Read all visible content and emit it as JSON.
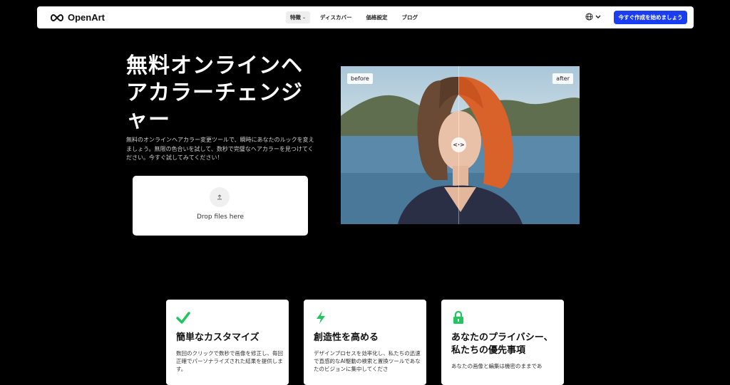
{
  "nav": {
    "logo": "OpenArt",
    "links": [
      {
        "label": "特徴",
        "has_chevron": true
      },
      {
        "label": "ディスカバー"
      },
      {
        "label": "価格設定"
      },
      {
        "label": "ブログ"
      }
    ],
    "cta": "今すぐ作成を始めましょう"
  },
  "hero": {
    "title_lines": [
      "無料オンラインヘ",
      "アカラーチェンジ",
      "ャー"
    ],
    "description": "無料のオンラインヘアカラー変更ツールで、瞬時にあなたのルックを変えましょう。無限の色合いを試して、数秒で完璧なヘアカラーを見つけてください。今すぐ試してみてください！",
    "upload_text": "Drop files here"
  },
  "compare": {
    "before_label": "before",
    "after_label": "after",
    "handle_glyph": "<·>"
  },
  "cards": [
    {
      "icon": "check-icon",
      "title": "簡単なカスタマイズ",
      "desc": "数回のクリックで数秒で画像を修正し、毎回正確でパーソナライズされた結果を提供します。",
      "color": "#22c55e"
    },
    {
      "icon": "lightning-icon",
      "title": "創造性を高める",
      "desc": "デザインプロセスを効率化し、私たちの迅速で直感的なAI駆動の検索と置換ツールであなたのビジョンに集中してくださ",
      "color": "#22c55e"
    },
    {
      "icon": "lock-icon",
      "title": "あなたのプライバシー、私たちの優先事項",
      "desc": "あなたの画像と編集は機密のままであ",
      "color": "#22c55e"
    }
  ]
}
